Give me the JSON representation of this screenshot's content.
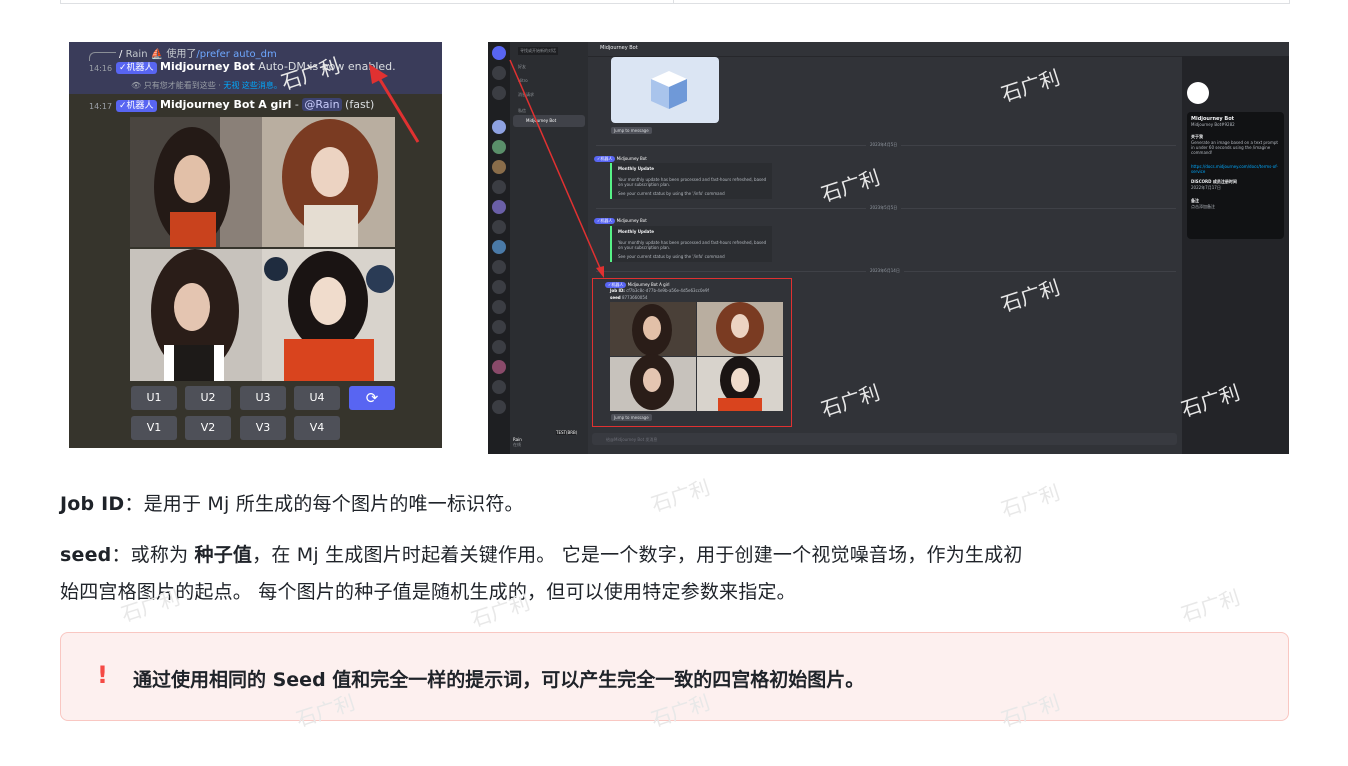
{
  "left_shot": {
    "reply_user": "Rain",
    "reply_action": "使用了",
    "reply_command": "/prefer auto_dm",
    "time1": "14:16",
    "bot_tag": "✓机器人",
    "bot_name": "Midjourney Bot",
    "msg1": "Auto-DM is now enabled.",
    "ephemeral_text": "只有您才能看到这些 · ",
    "ephemeral_link": "无视 这些消息。",
    "time2": "14:17",
    "prompt": "A girl",
    "mention": "@Rain",
    "speed": "(fast)",
    "buttons_u": [
      "U1",
      "U2",
      "U3",
      "U4"
    ],
    "buttons_v": [
      "V1",
      "V2",
      "V3",
      "V4"
    ],
    "reroll_icon": "refresh-icon"
  },
  "right_shot": {
    "search_hint": "寻找或开始新的对话",
    "channel_title": "Midjourney Bot",
    "nav": [
      "好友",
      "Nitro",
      "消息请求"
    ],
    "dm_header": "私信",
    "dm_item": "Midjourney Bot",
    "jump_label": "Jump to message",
    "date1": "2023年4月5日",
    "date2": "2023年5月5日",
    "date3": "2023年6月14日",
    "bot_tag": "✓机器人",
    "bot_name": "Midjourney Bot",
    "embed_title": "Monthly Update",
    "embed_body": "Your monthly update has been processed and fast-hours refreshed, based on your subscription plan.",
    "embed_note": "See your current status by using the '/info' command",
    "job_line": "Midjourney Bot  A girl",
    "job_id_label": "Job ID:",
    "job_id": "cf7b3c8c-d77b-4e9b-a56e-4d5e63cc0e9f",
    "seed_label": "seed",
    "seed": "8773660054",
    "input_placeholder": "给@Midjourney Bot 发消息",
    "user_name": "Rain",
    "user_status": "在线",
    "profile_name": "Midjourney Bot",
    "profile_tag": "Midjourney Bot#9282",
    "profile_about_h": "关于我",
    "profile_about": "Generate an image based on a text prompt in under 60 seconds using the /imagine command!",
    "profile_link": "https://docs.midjourney.com/docs/terms-of-service",
    "profile_member_h": "DISCORD 成员注册时间",
    "profile_member": "2022年7月17日",
    "profile_note_h": "备注",
    "profile_note": "点击添加备注",
    "test_badge": "TEST(BRB)"
  },
  "para1": {
    "label": "Job ID",
    "text": "：是用于 Mj 所生成的每个图片的唯一标识符。"
  },
  "para2": {
    "label": "seed",
    "pre": "：或称为 ",
    "strong": "种子值",
    "line1_rest": "，在 Mj 生成图片时起着关键作用。 它是一个数字，用于创建一个视觉噪音场，作为生成初",
    "line2": "始四宫格图片的起点。 每个图片的种子值是随机生成的，但可以使用特定参数来指定。"
  },
  "callout": {
    "icon": "exclamation-icon",
    "text": "通过使用相同的 Seed 值和完全一样的提示词，可以产生完全一致的四宫格初始图片。"
  },
  "watermark": "石广利",
  "colors": {
    "accent_red": "#f54a45",
    "discord_blurple": "#5865f2",
    "discord_bg": "#313338"
  }
}
